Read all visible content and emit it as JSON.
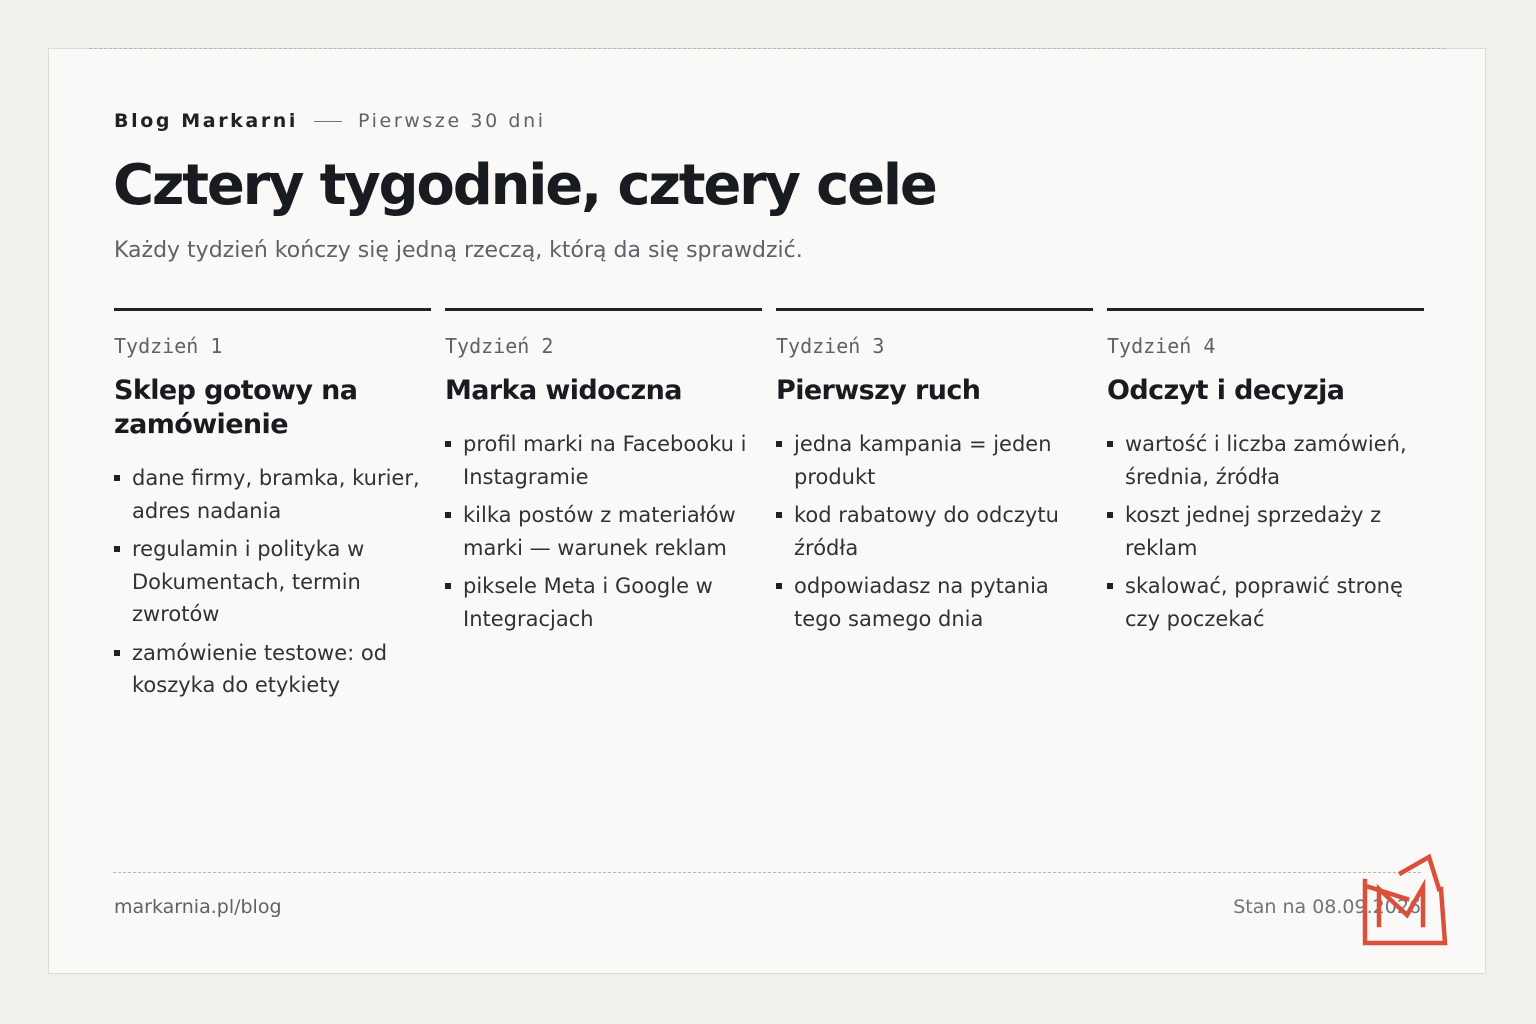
{
  "header": {
    "brand": "Blog Markarni",
    "series": "Pierwsze 30 dni",
    "title": "Cztery tygodnie, cztery cele",
    "subtitle": "Każdy tydzień kończy się jedną rzeczą, którą da się sprawdzić."
  },
  "weeks": [
    {
      "label": "Tydzień 1",
      "title": "Sklep gotowy na zamówienie",
      "items": [
        "dane firmy, bramka, kurier, adres nadania",
        "regulamin i polityka w Dokumentach, termin zwrotów",
        "zamówienie testowe: od koszyka do etykiety"
      ]
    },
    {
      "label": "Tydzień 2",
      "title": "Marka widoczna",
      "items": [
        "profil marki na Facebooku i Instagramie",
        "kilka postów z materiałów marki — warunek reklam",
        "piksele Meta i Google w Integracjach"
      ]
    },
    {
      "label": "Tydzień 3",
      "title": "Pierwszy ruch",
      "items": [
        "jedna kampania = jeden produkt",
        "kod rabatowy do odczytu źródła",
        "odpowiadasz na pytania tego samego dnia"
      ]
    },
    {
      "label": "Tydzień 4",
      "title": "Odczyt i decyzja",
      "items": [
        "wartość i liczba zamówień, średnia, źródła",
        "koszt jednej sprzedaży z reklam",
        "skalować, poprawić stronę czy poczekać"
      ]
    }
  ],
  "footer": {
    "url": "markarnia.pl/blog",
    "date": "Stan na 08.09.2026"
  },
  "logo": {
    "icon": "markarnia-m-logo-icon",
    "color": "#d9513a"
  },
  "colors": {
    "background": "#f1f0ec",
    "card": "#faf9f7",
    "ink": "#1f2328",
    "muted": "#5d636a"
  }
}
